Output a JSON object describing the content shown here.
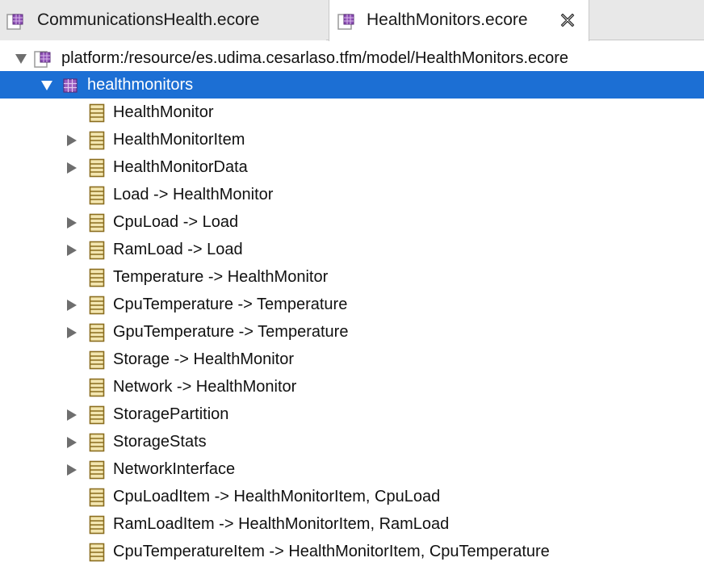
{
  "tabs": [
    {
      "label": "CommunicationsHealth.ecore",
      "active": false,
      "icon": "ecore-package-icon"
    },
    {
      "label": "HealthMonitors.ecore",
      "active": true,
      "icon": "ecore-package-icon",
      "close_icon": "close-icon"
    }
  ],
  "tree": {
    "resource": {
      "label": "platform:/resource/es.udima.cesarlaso.tfm/model/HealthMonitors.ecore",
      "expanded": true,
      "icon": "ecore-resource-icon"
    },
    "package": {
      "label": "healthmonitors",
      "expanded": true,
      "selected": true,
      "icon": "epackage-icon"
    },
    "classes": [
      {
        "label": "HealthMonitor",
        "expandable": false,
        "icon": "eclass-icon"
      },
      {
        "label": "HealthMonitorItem",
        "expandable": true,
        "icon": "eclass-icon"
      },
      {
        "label": "HealthMonitorData",
        "expandable": true,
        "icon": "eclass-icon"
      },
      {
        "label": "Load -> HealthMonitor",
        "expandable": false,
        "icon": "eclass-icon"
      },
      {
        "label": "CpuLoad -> Load",
        "expandable": true,
        "icon": "eclass-icon"
      },
      {
        "label": "RamLoad -> Load",
        "expandable": true,
        "icon": "eclass-icon"
      },
      {
        "label": "Temperature -> HealthMonitor",
        "expandable": false,
        "icon": "eclass-icon"
      },
      {
        "label": "CpuTemperature -> Temperature",
        "expandable": true,
        "icon": "eclass-icon"
      },
      {
        "label": "GpuTemperature -> Temperature",
        "expandable": true,
        "icon": "eclass-icon"
      },
      {
        "label": "Storage -> HealthMonitor",
        "expandable": false,
        "icon": "eclass-icon"
      },
      {
        "label": "Network -> HealthMonitor",
        "expandable": false,
        "icon": "eclass-icon"
      },
      {
        "label": "StoragePartition",
        "expandable": true,
        "icon": "eclass-icon"
      },
      {
        "label": "StorageStats",
        "expandable": true,
        "icon": "eclass-icon"
      },
      {
        "label": "NetworkInterface",
        "expandable": true,
        "icon": "eclass-icon"
      },
      {
        "label": "CpuLoadItem -> HealthMonitorItem, CpuLoad",
        "expandable": false,
        "icon": "eclass-icon"
      },
      {
        "label": "RamLoadItem -> HealthMonitorItem, RamLoad",
        "expandable": false,
        "icon": "eclass-icon"
      },
      {
        "label": "CpuTemperatureItem -> HealthMonitorItem, CpuTemperature",
        "expandable": false,
        "icon": "eclass-icon"
      }
    ]
  },
  "colors": {
    "selection": "#1c6fd4",
    "package_icon": "#7b3fa0",
    "class_icon_fill": "#f3e6b0",
    "class_icon_stroke": "#8a6d1e",
    "arrow": "#6e6e6e"
  }
}
